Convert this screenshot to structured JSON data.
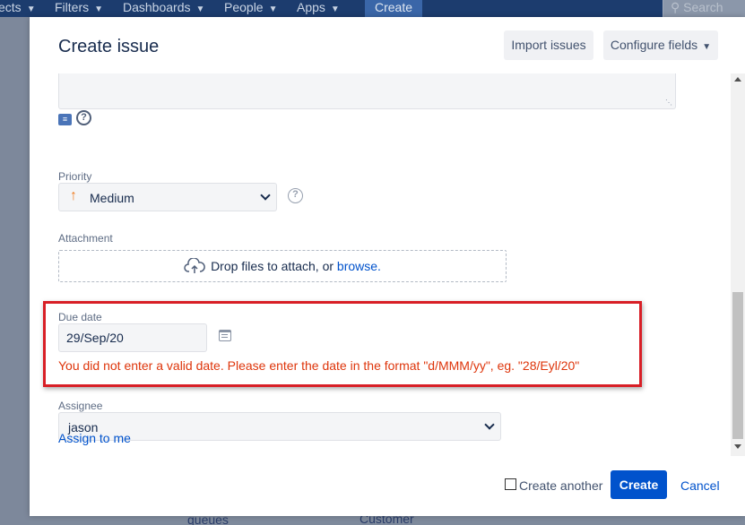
{
  "background": {
    "nav": {
      "items": [
        {
          "label": "ects"
        },
        {
          "label": "Filters"
        },
        {
          "label": "Dashboards"
        },
        {
          "label": "People"
        },
        {
          "label": "Apps"
        }
      ],
      "create_label": "Create",
      "search_placeholder": "Search"
    },
    "page_texts": [
      "queues",
      "Customer"
    ]
  },
  "dialog": {
    "title": "Create issue",
    "import_label": "Import issues",
    "configure_label": "Configure fields",
    "priority": {
      "label": "Priority",
      "value": "Medium",
      "icon": "arrow-up-icon",
      "icon_color": "#f07c20"
    },
    "attachment": {
      "label": "Attachment",
      "text": "Drop files to attach, or",
      "browse_label": "browse."
    },
    "due_date": {
      "label": "Due date",
      "value": "29/Sep/20",
      "error": "You did not enter a valid date. Please enter the date in the format \"d/MMM/yy\", eg. \"28/Eyl/20\""
    },
    "assignee": {
      "label": "Assignee",
      "value": "jason",
      "assign_to_me_label": "Assign to me"
    },
    "footer": {
      "create_another_label": "Create another",
      "create_another_checked": false,
      "create_label": "Create",
      "cancel_label": "Cancel"
    }
  },
  "colors": {
    "primary": "#0052cc",
    "error": "#de350b",
    "highlight_box": "#d81f26",
    "nav_background": "#1c3c6e"
  }
}
